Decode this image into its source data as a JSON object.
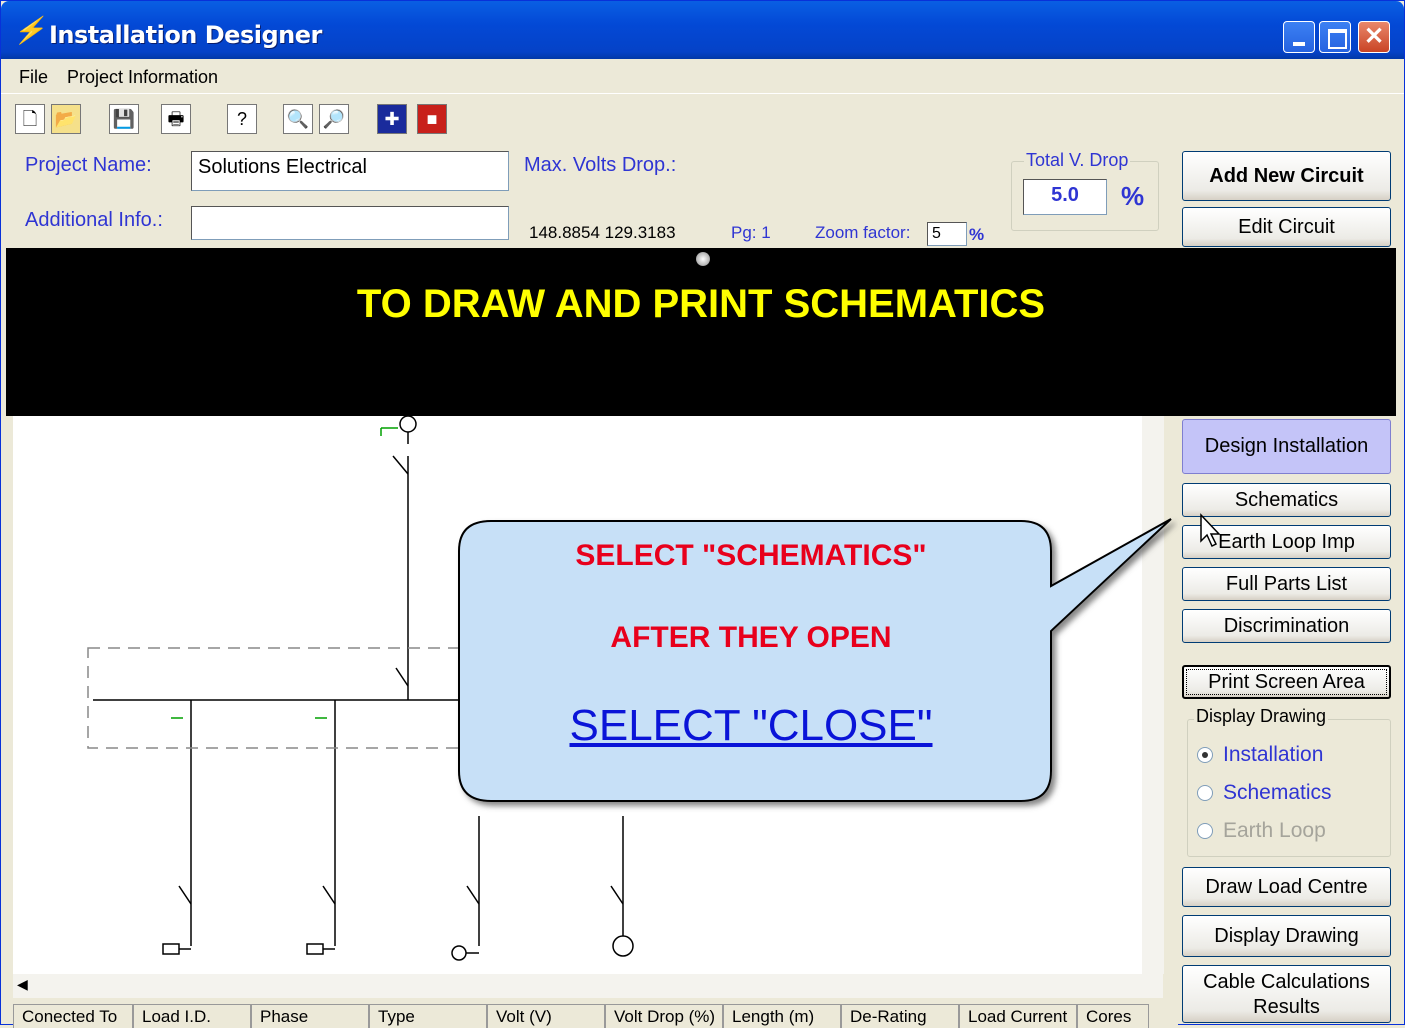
{
  "window": {
    "title": "Installation Designer",
    "controls": {
      "close_glyph": "✕"
    }
  },
  "menu": [
    "File",
    "Project Information"
  ],
  "toolbar": {
    "icons": [
      "new-file-icon",
      "open-folder-icon",
      "save-icon",
      "print-icon",
      "help-icon",
      "print-preview-icon",
      "page-preview-icon",
      "uk-flag-icon",
      "alt-flag-icon"
    ]
  },
  "project": {
    "name_label": "Project Name:",
    "name_value": "Solutions Electrical",
    "info_label": "Additional Info.:",
    "info_value": "",
    "max_volts_label": "Max. Volts Drop.:",
    "coords": "148.8854 129.3183",
    "page": "Pg: 1",
    "zoom_label": "Zoom factor:",
    "zoom_value": "5",
    "zoom_unit": "%"
  },
  "total_vdrop": {
    "title": "Total V. Drop",
    "value": "5.0",
    "unit": "%"
  },
  "buttons": {
    "add_circuit": "Add New Circuit",
    "edit_circuit": "Edit Circuit",
    "design_installation": "Design Installation",
    "schematics": "Schematics",
    "earth_loop": "Earth Loop Imp",
    "parts_list": "Full Parts List",
    "discrimination": "Discrimination",
    "print_screen": "Print Screen Area",
    "draw_load_centre": "Draw Load Centre",
    "display_drawing": "Display Drawing",
    "cable_calc_line1": "Cable Calculations",
    "cable_calc_line2": "Results"
  },
  "display_group": {
    "title": "Display Drawing",
    "options": [
      {
        "label": "Installation",
        "checked": true,
        "enabled": true
      },
      {
        "label": "Schematics",
        "checked": false,
        "enabled": true
      },
      {
        "label": "Earth Loop",
        "checked": false,
        "enabled": false
      }
    ]
  },
  "banner": {
    "text": "TO DRAW AND PRINT SCHEMATICS"
  },
  "callout": {
    "line1": "SELECT \"SCHEMATICS\"",
    "line2": "AFTER THEY OPEN",
    "line3": "SELECT \"CLOSE\"",
    "red": "#E8001C",
    "blue": "#0A14D8"
  },
  "table": {
    "headers": [
      "Conected To",
      "Load I.D.",
      "Phase",
      "Type",
      "Volt (V)",
      "Volt Drop (%)",
      "Length (m)",
      "De-Rating",
      "Load Current",
      "Cores"
    ]
  }
}
